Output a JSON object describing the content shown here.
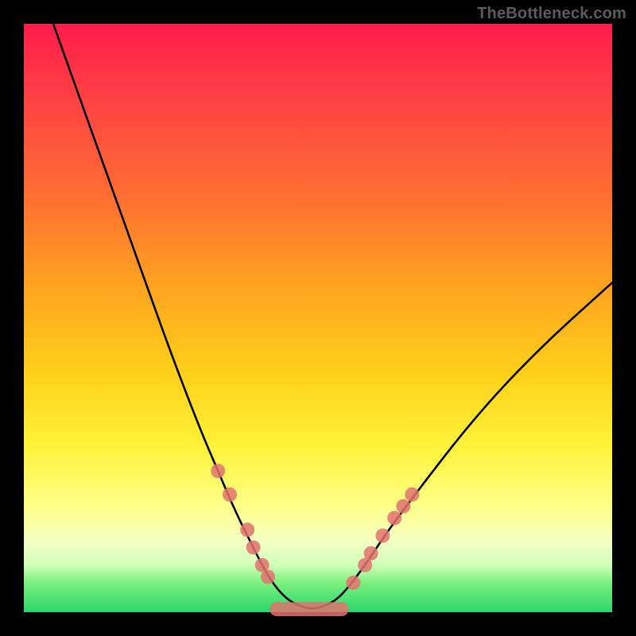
{
  "watermark": "TheBottleneck.com",
  "colors": {
    "frame_bg": "#000000",
    "dot": "#e2726f",
    "curve": "#000000",
    "gradient_stops": [
      "#ff1c4a",
      "#ff3f43",
      "#ff6a33",
      "#ffa41f",
      "#ffd21a",
      "#fff33a",
      "#fdff88",
      "#f4ffc2",
      "#d1ffb8",
      "#7cf07e",
      "#28d86b"
    ]
  },
  "chart_data": {
    "type": "line",
    "title": "",
    "xlabel": "",
    "ylabel": "",
    "xlim": [
      0,
      100
    ],
    "ylim": [
      0,
      100
    ],
    "grid": false,
    "legend": false,
    "notes": "V-shaped bottleneck curve. Curve is thin black over a rainbow vertical gradient inside a black frame. Salmon dots mark sample points on both flanks of the V; a wide salmon lobe sits at the valley floor. Y is plotted with 0 at the bottom. X is an arbitrary component-balance axis; Y is percent bottleneck.",
    "series": [
      {
        "name": "bottleneck-curve",
        "x": [
          5,
          10,
          15,
          20,
          25,
          30,
          33,
          36,
          39,
          41,
          43,
          45,
          47,
          49,
          51,
          53,
          55,
          58,
          62,
          68,
          75,
          82,
          90,
          100
        ],
        "y": [
          100,
          86,
          72,
          58,
          44,
          31,
          24,
          17,
          11,
          7,
          4,
          2,
          1,
          0.5,
          1,
          2,
          4,
          8,
          14,
          22,
          31,
          39,
          47,
          56
        ]
      }
    ],
    "markers_left": [
      {
        "x": 33,
        "y": 24
      },
      {
        "x": 35,
        "y": 20
      },
      {
        "x": 38,
        "y": 14
      },
      {
        "x": 39,
        "y": 11
      },
      {
        "x": 40.5,
        "y": 8
      },
      {
        "x": 41.5,
        "y": 6
      }
    ],
    "markers_right": [
      {
        "x": 56,
        "y": 5
      },
      {
        "x": 58,
        "y": 8
      },
      {
        "x": 59,
        "y": 10
      },
      {
        "x": 61,
        "y": 13
      },
      {
        "x": 63,
        "y": 16
      },
      {
        "x": 64.5,
        "y": 18
      },
      {
        "x": 66,
        "y": 20
      }
    ],
    "valley_lobe": {
      "x_start": 43,
      "x_end": 54,
      "y": 0.5,
      "half_height": 1.2
    }
  }
}
